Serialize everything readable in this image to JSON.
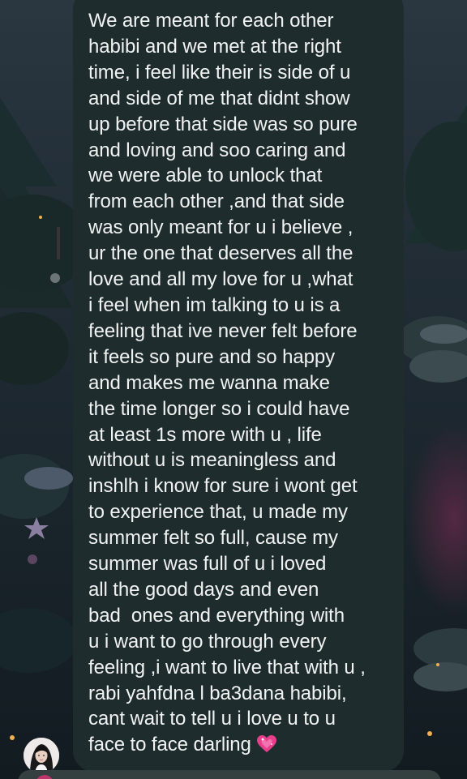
{
  "message": {
    "lines": [
      "We are meant for each other",
      "habibi and we met at the right",
      "time, i feel like their is side of u",
      "and side of me that didnt show",
      "up before that side was so pure",
      "and loving and soo caring and",
      "we were able to unlock that",
      "from each other ,and that side",
      "was only meant for u i believe ,",
      "ur the one that deserves all the",
      "love and all my love for u ,what",
      "i feel when im talking to u is a",
      "feeling that ive never felt before",
      "it feels so pure and so happy",
      "and makes me wanna make",
      "the time longer so i could have",
      "at least 1s more with u , life",
      "without u is meaningless and",
      "inshlh i know for sure i wont get",
      "to experience that, u made my",
      "summer felt so full, cause my",
      "summer was full of u i loved",
      "all the good days and even",
      "bad  ones and everything with",
      "u i want to go through every",
      "feeling ,i want to live that with u ,",
      "rabi yahfdna l ba3dana habibi,",
      "cant wait to tell u i love u to u",
      "face to face darling"
    ],
    "emoji": "sparkling-heart-emoji"
  },
  "sender": {
    "avatar": "profile-photo"
  },
  "colors": {
    "bubble": "#1f2c2e",
    "text": "#f1f3f2",
    "heart": "#e83e8c"
  }
}
